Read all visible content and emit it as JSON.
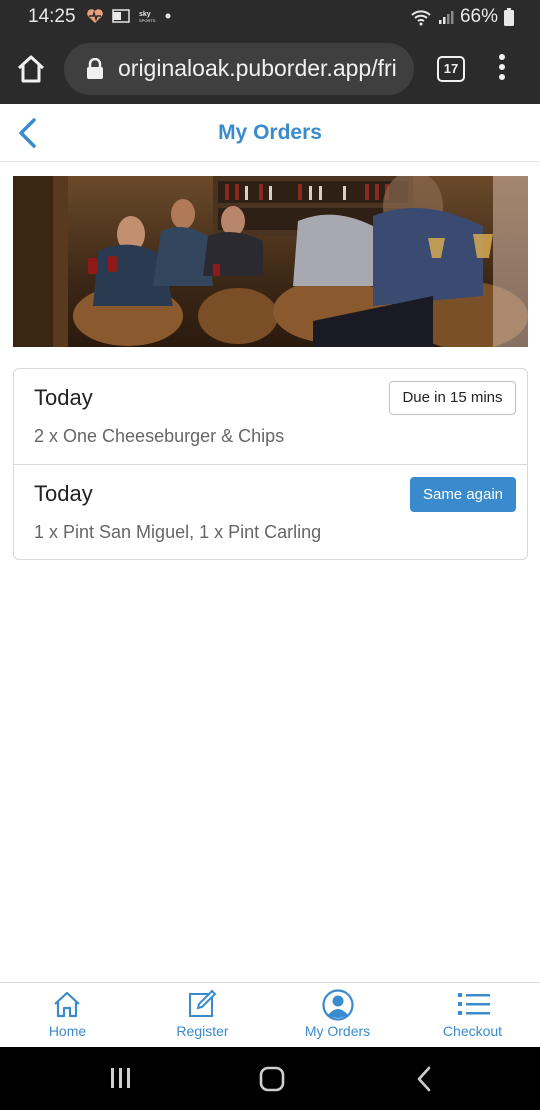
{
  "status_bar": {
    "time": "14:25",
    "battery": "66%"
  },
  "browser": {
    "url": "originaloak.puborder.app/fri",
    "tab_count": "17"
  },
  "header": {
    "title": "My Orders"
  },
  "orders": [
    {
      "date": "Today",
      "items": "2 x One Cheeseburger & Chips",
      "status": "Due in 15 mins"
    },
    {
      "date": "Today",
      "items": "1 x Pint San Miguel, 1 x Pint Carling",
      "action": "Same again"
    }
  ],
  "bottom_nav": {
    "items": [
      {
        "label": "Home",
        "icon": "home-icon"
      },
      {
        "label": "Register",
        "icon": "edit-icon"
      },
      {
        "label": "My Orders",
        "icon": "user-icon"
      },
      {
        "label": "Checkout",
        "icon": "list-icon"
      }
    ]
  },
  "colors": {
    "accent": "#3a8bcd",
    "chrome": "#2b2b2b"
  }
}
